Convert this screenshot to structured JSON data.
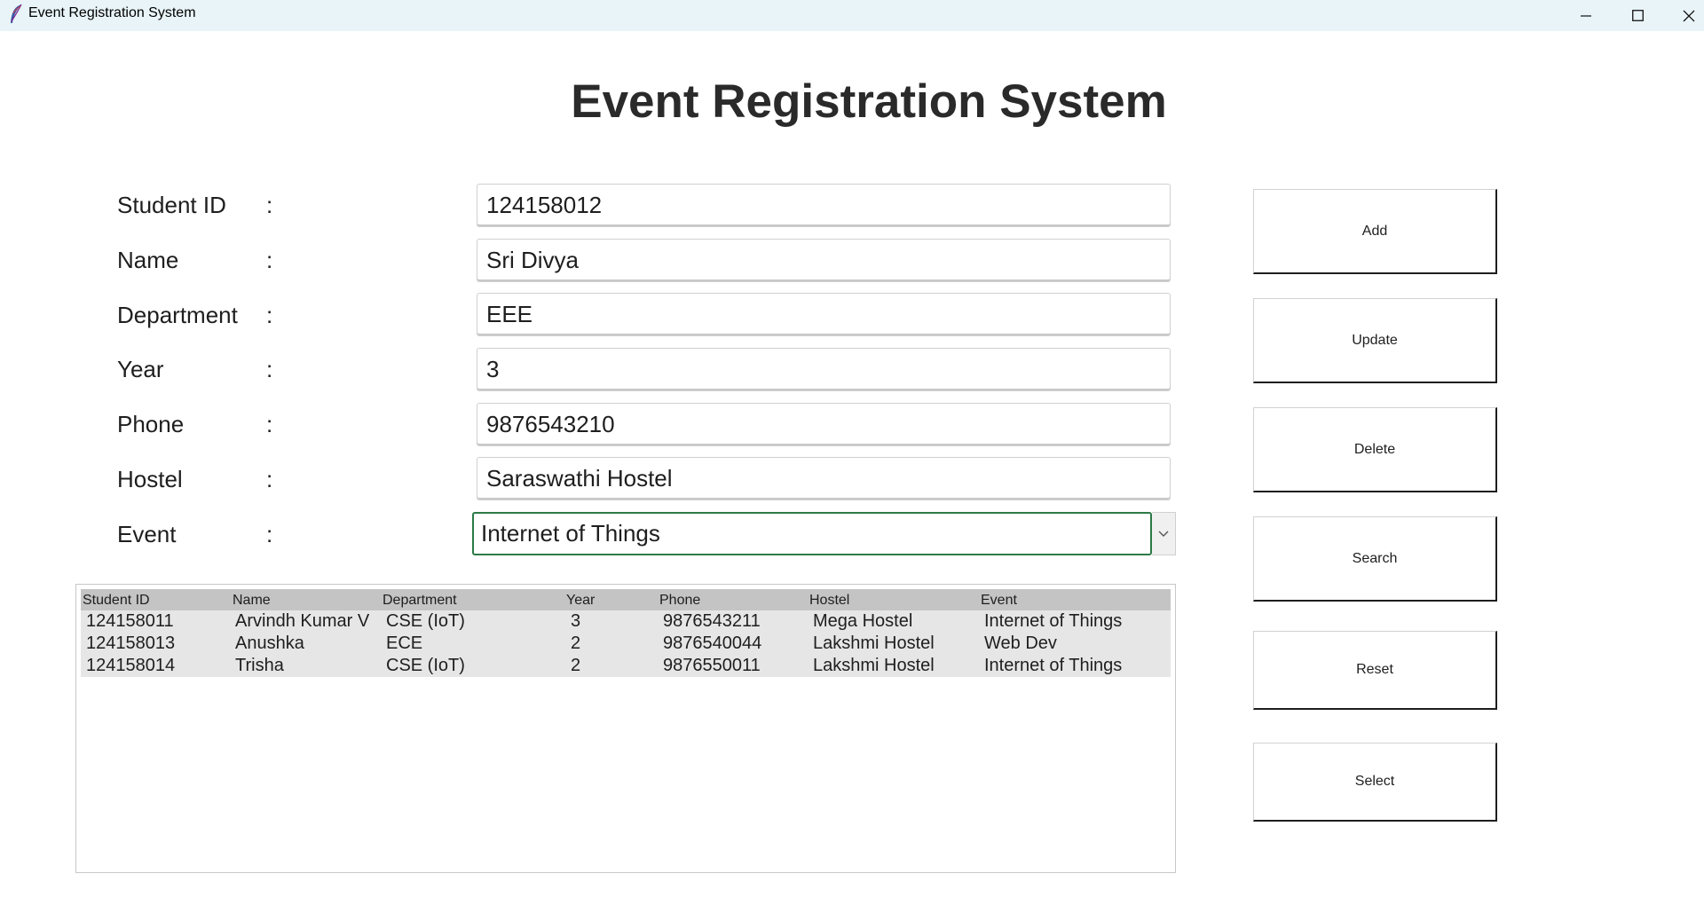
{
  "window": {
    "title": "Event Registration System",
    "icon": "feather-icon"
  },
  "header": {
    "title": "Event Registration System"
  },
  "form": {
    "colon": ":",
    "fields": [
      {
        "label": "Student ID",
        "value": "124158012"
      },
      {
        "label": "Name",
        "value": "Sri Divya"
      },
      {
        "label": "Department",
        "value": "EEE"
      },
      {
        "label": "Year",
        "value": "3"
      },
      {
        "label": "Phone",
        "value": "9876543210"
      },
      {
        "label": "Hostel",
        "value": "Saraswathi Hostel"
      }
    ],
    "event": {
      "label": "Event",
      "value": "Internet of Things"
    }
  },
  "table": {
    "columns": [
      "Student ID",
      "Name",
      "Department",
      "Year",
      "Phone",
      "Hostel",
      "Event"
    ],
    "rows": [
      [
        "124158011",
        "Arvindh Kumar V",
        "CSE (IoT)",
        "3",
        "9876543211",
        "Mega Hostel",
        "Internet of Things"
      ],
      [
        "124158013",
        "Anushka",
        "ECE",
        "2",
        "9876540044",
        "Lakshmi Hostel",
        "Web Dev"
      ],
      [
        "124158014",
        "Trisha",
        "CSE (IoT)",
        "2",
        "9876550011",
        "Lakshmi Hostel",
        "Internet of Things"
      ]
    ]
  },
  "buttons": {
    "add": "Add",
    "update": "Update",
    "delete": "Delete",
    "search": "Search",
    "reset": "Reset",
    "select": "Select"
  },
  "colors": {
    "combo_focus_border": "#2c7a45",
    "titlebar_bg": "#e8f4f8",
    "table_header_bg": "#c4c4c4",
    "table_rows_bg": "#e6e6e6"
  }
}
